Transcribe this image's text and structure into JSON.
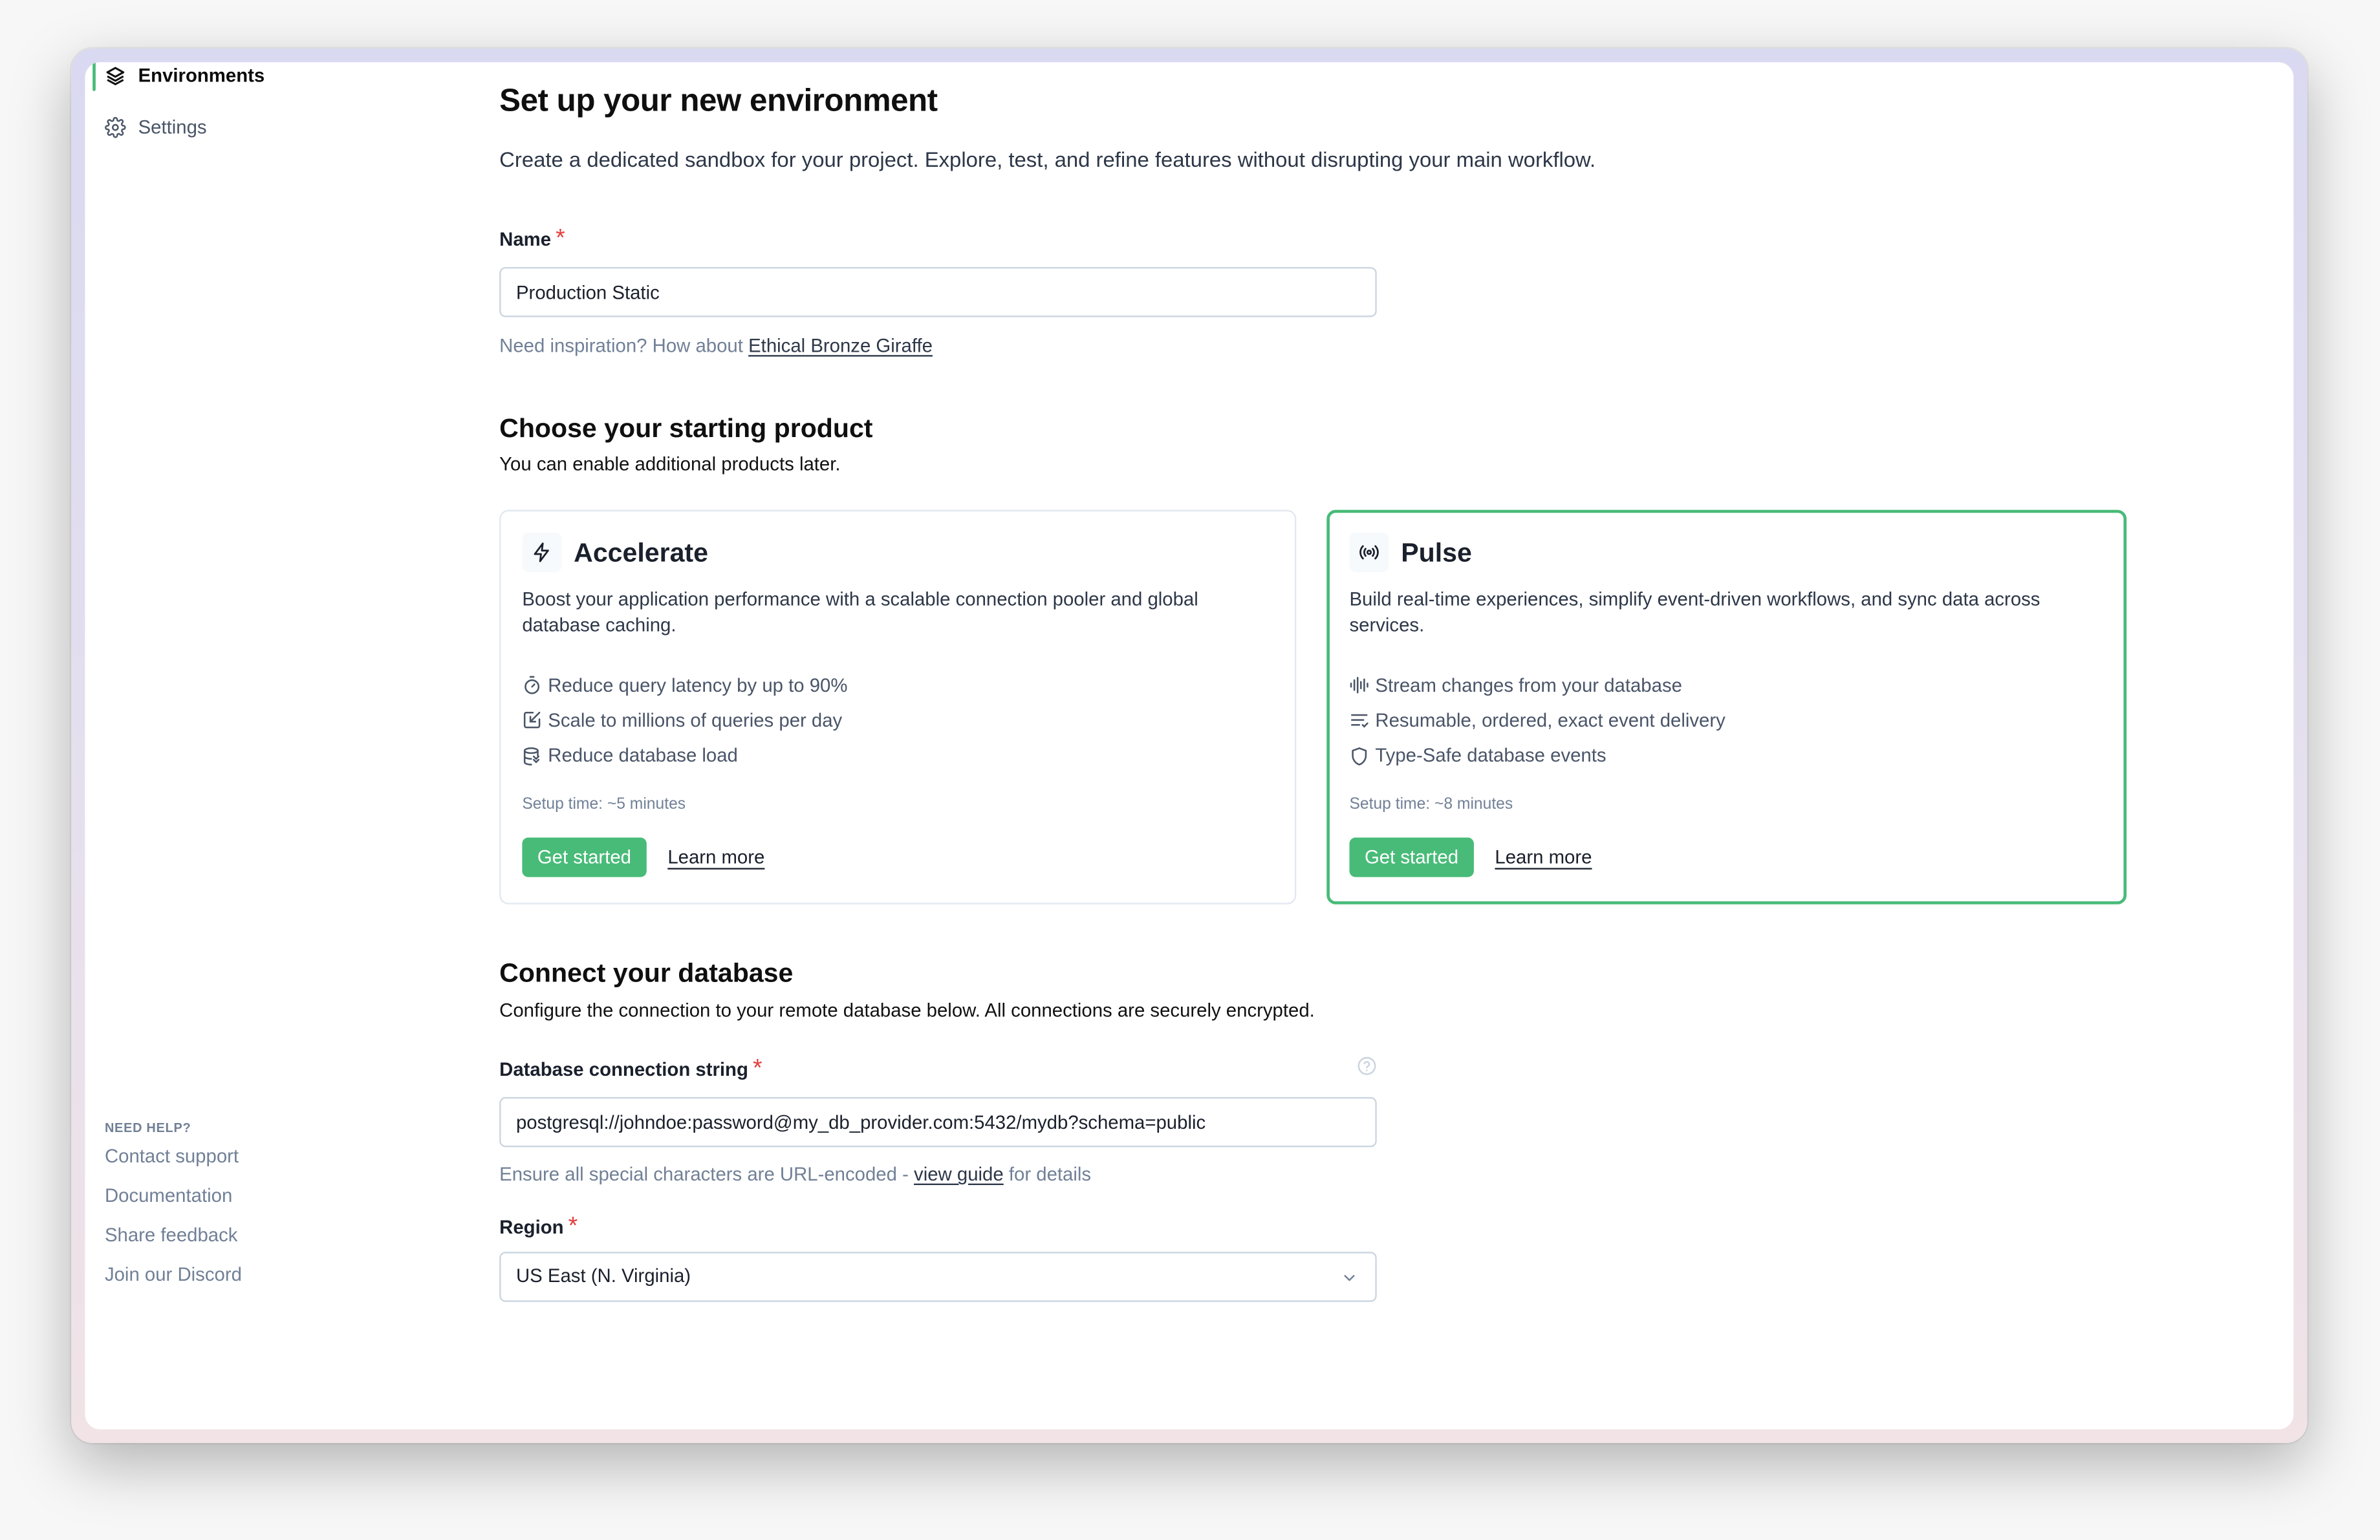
{
  "sidebar": {
    "items": [
      {
        "label": "Environments",
        "icon": "layers-icon",
        "active": true
      },
      {
        "label": "Settings",
        "icon": "gear-icon",
        "active": false
      }
    ],
    "help": {
      "title": "NEED HELP?",
      "links": [
        "Contact support",
        "Documentation",
        "Share feedback",
        "Join our Discord"
      ]
    }
  },
  "header": {
    "title": "Set up your new environment",
    "subtitle": "Create a dedicated sandbox for your project. Explore, test, and refine features without disrupting your main workflow."
  },
  "name_field": {
    "label": "Name",
    "required_mark": "*",
    "value": "Production Static",
    "hint_prefix": "Need inspiration? How about",
    "suggestion": "Ethical Bronze Giraffe"
  },
  "product_section": {
    "title": "Choose your starting product",
    "description": "You can enable additional products later.",
    "cards": [
      {
        "name": "Accelerate",
        "icon": "lightning-bolt-icon",
        "selected": false,
        "description": "Boost your application performance with a scalable connection pooler and global database caching.",
        "features": [
          {
            "icon": "stopwatch-icon",
            "text": "Reduce query latency by up to 90%"
          },
          {
            "icon": "scale-arrow-icon",
            "text": "Scale to millions of queries per day"
          },
          {
            "icon": "database-check-icon",
            "text": "Reduce database load"
          }
        ],
        "setup_time": "Setup time: ~5 minutes",
        "primary_label": "Get started",
        "secondary_label": "Learn more"
      },
      {
        "name": "Pulse",
        "icon": "broadcast-icon",
        "selected": true,
        "description": "Build real-time experiences, simplify event-driven workflows, and sync data across services.",
        "features": [
          {
            "icon": "audio-wave-icon",
            "text": "Stream changes from your database"
          },
          {
            "icon": "list-check-icon",
            "text": "Resumable, ordered, exact event delivery"
          },
          {
            "icon": "shield-icon",
            "text": "Type-Safe database events"
          }
        ],
        "setup_time": "Setup time: ~8 minutes",
        "primary_label": "Get started",
        "secondary_label": "Learn more"
      }
    ]
  },
  "database_section": {
    "title": "Connect your database",
    "description": "Configure the connection to your remote database below. All connections are securely encrypted.",
    "connection_label": "Database connection string",
    "required_mark": "*",
    "connection_value": "postgresql://johndoe:password@my_db_provider.com:5432/mydb?schema=public",
    "hint_prefix": "Ensure all special characters are URL-encoded -",
    "hint_link": "view guide",
    "hint_suffix": "for details",
    "region_label": "Region",
    "region_value": "US East (N. Virginia)"
  },
  "colors": {
    "accent": "#48bb78",
    "required": "#e53e3e",
    "muted_text": "#718096"
  }
}
